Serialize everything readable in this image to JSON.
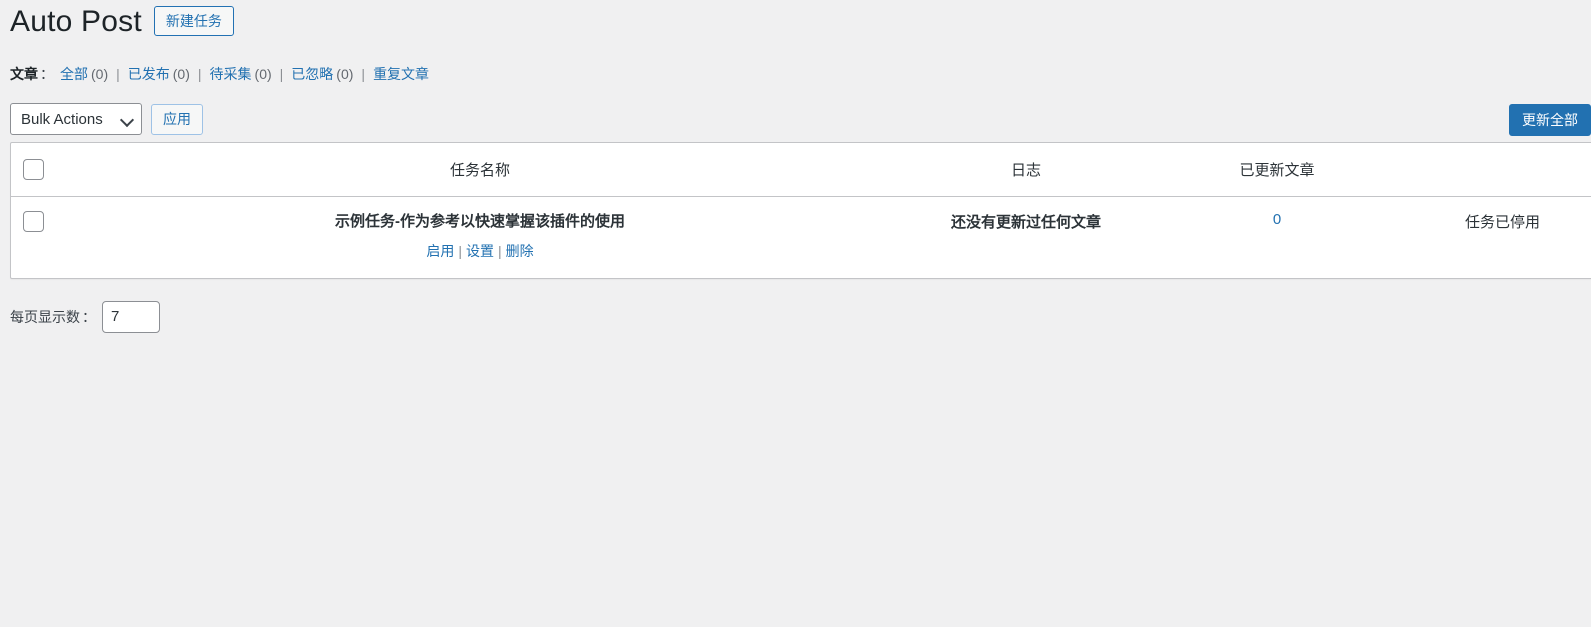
{
  "header": {
    "title": "Auto Post",
    "new_task_button": "新建任务"
  },
  "filters": {
    "label": "文章",
    "colon": "：",
    "separator": "|",
    "items": [
      {
        "label": "全部",
        "count": "(0)"
      },
      {
        "label": "已发布",
        "count": "(0)"
      },
      {
        "label": "待采集",
        "count": "(0)"
      },
      {
        "label": "已忽略",
        "count": "(0)"
      },
      {
        "label": "重复文章",
        "count": ""
      }
    ]
  },
  "tablenav": {
    "bulk_actions_label": "Bulk Actions",
    "apply_button": "应用",
    "update_all_button": "更新全部"
  },
  "table": {
    "columns": {
      "name": "任务名称",
      "log": "日志",
      "updated": "已更新文章"
    },
    "rows": [
      {
        "title": "示例任务-作为参考以快速掌握该插件的使用",
        "actions": [
          "启用",
          "设置",
          "删除"
        ],
        "action_separator": "|",
        "log": "还没有更新过任何文章",
        "updated_count": "0",
        "status": "任务已停用"
      }
    ]
  },
  "footer": {
    "per_page_label": "每页显示数",
    "per_page_colon": "：",
    "per_page_value": "7"
  },
  "colors": {
    "accent": "#2271b1",
    "page_background": "#f0f0f1",
    "table_border": "#c3c4c7"
  }
}
